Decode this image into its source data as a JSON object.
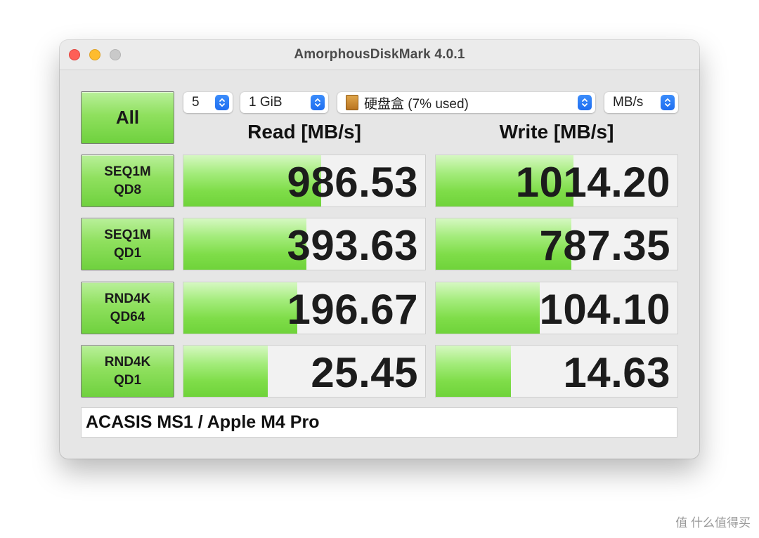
{
  "window": {
    "title": "AmorphousDiskMark 4.0.1"
  },
  "controls": {
    "all_label": "All",
    "count": "5",
    "size": "1 GiB",
    "disk": "硬盘盒 (7% used)",
    "unit": "MB/s"
  },
  "headers": {
    "read": "Read [MB/s]",
    "write": "Write [MB/s]"
  },
  "tests": [
    {
      "line1": "SEQ1M",
      "line2": "QD8",
      "read": "986.53",
      "write": "1014.20",
      "read_fill": 0.57,
      "write_fill": 0.57
    },
    {
      "line1": "SEQ1M",
      "line2": "QD1",
      "read": "393.63",
      "write": "787.35",
      "read_fill": 0.51,
      "write_fill": 0.56
    },
    {
      "line1": "RND4K",
      "line2": "QD64",
      "read": "196.67",
      "write": "104.10",
      "read_fill": 0.47,
      "write_fill": 0.43
    },
    {
      "line1": "RND4K",
      "line2": "QD1",
      "read": "25.45",
      "write": "14.63",
      "read_fill": 0.35,
      "write_fill": 0.31
    }
  ],
  "comment": "ACASIS MS1 / Apple M4 Pro",
  "watermark": "值 什么值得买"
}
